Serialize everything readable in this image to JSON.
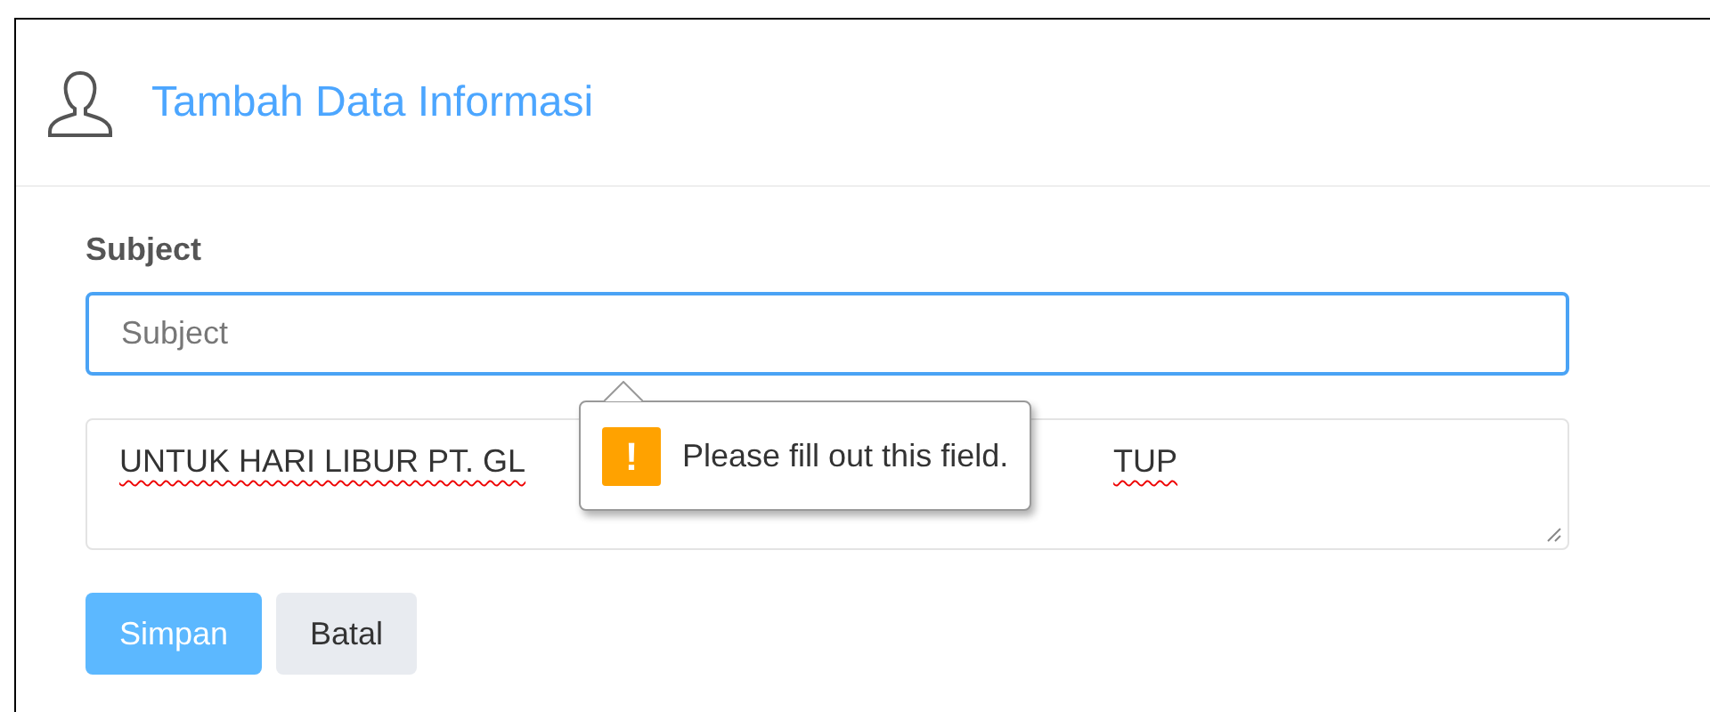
{
  "header": {
    "title": "Tambah Data Informasi"
  },
  "form": {
    "subject_label": "Subject",
    "subject_placeholder": "Subject",
    "subject_focused": true,
    "message_visible_start": "UNTUK HARI LIBUR PT. GL",
    "message_visible_end": "TUP"
  },
  "validation_tooltip": {
    "icon": "!",
    "message": "Please fill out this field."
  },
  "buttons": [
    {
      "label": "Simpan",
      "kind": "primary"
    },
    {
      "label": "Batal",
      "kind": "secondary"
    }
  ]
}
